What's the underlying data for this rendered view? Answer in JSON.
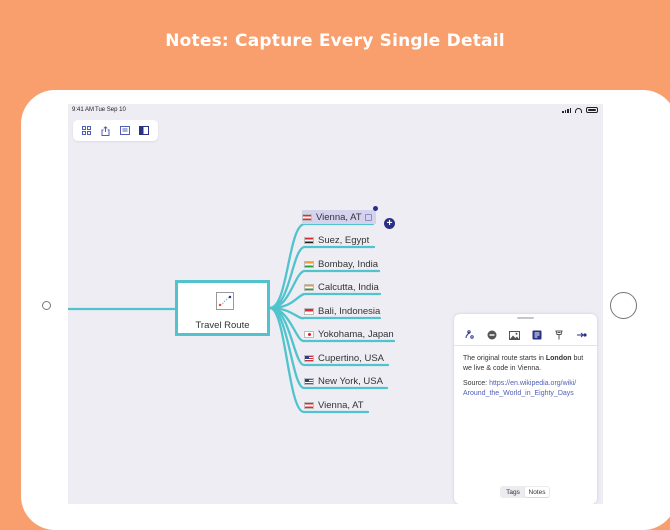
{
  "headline": "Notes: Capture Every Single Detail",
  "status_bar": {
    "time": "9:41 AM",
    "date": "Tue Sep 10"
  },
  "toolbar": {
    "buttons": [
      "grid-icon",
      "share-icon",
      "outline-icon",
      "sidebar-icon"
    ]
  },
  "mindmap": {
    "center": {
      "label": "Travel Route",
      "icon": "map-route-icon"
    },
    "nodes": [
      {
        "label": "Vienna, AT",
        "flag": "AT",
        "selected": true,
        "has_note": true
      },
      {
        "label": "Suez, Egypt",
        "flag": "EG"
      },
      {
        "label": "Bombay, India",
        "flag": "IN"
      },
      {
        "label": "Calcutta, India",
        "flag": "IN"
      },
      {
        "label": "Bali, Indonesia",
        "flag": "ID"
      },
      {
        "label": "Yokohama, Japan",
        "flag": "JP"
      },
      {
        "label": "Cupertino, USA",
        "flag": "US"
      },
      {
        "label": "New York, USA",
        "flag": "US"
      },
      {
        "label": "Vienna, AT",
        "flag": "AT"
      }
    ],
    "add_button": "+"
  },
  "inspector": {
    "tools": [
      "style-icon",
      "remove-icon",
      "image-icon",
      "notes-icon",
      "tag-icon",
      "connection-icon"
    ],
    "active_tool": "notes-icon",
    "note": {
      "line1_pre": "The original route starts in ",
      "line1_bold": "London",
      "line1_post": " but we live & code in Vienna.",
      "source_label": "Source: ",
      "source_url": "https://en.wikipedia.org/wiki/Around_the_World_in_Eighty_Days",
      "source_url_line1": "https://en.wikipedia.org/wiki/",
      "source_url_line2": "Around_the_World_in_Eighty_Days"
    },
    "segments": [
      "Tags",
      "Notes"
    ],
    "active_segment": "Notes"
  },
  "colors": {
    "background": "#F99F6E",
    "branch": "#51C3CC",
    "accent": "#2B3087",
    "selection": "#D4D3EE",
    "canvas": "#EEEDF4"
  }
}
